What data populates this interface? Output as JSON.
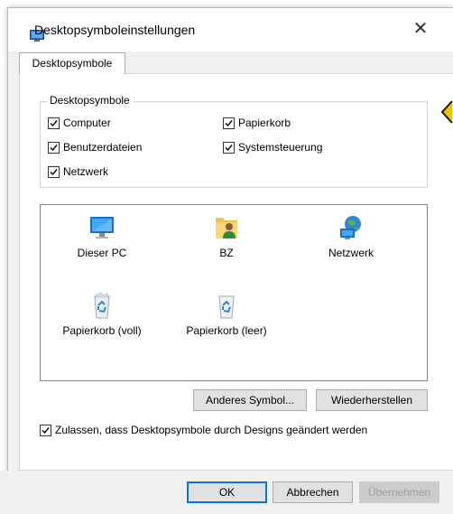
{
  "window": {
    "title": "Desktopsymboleinstellungen",
    "close_glyph": "✕"
  },
  "tabs": [
    {
      "label": "Desktopsymbole"
    }
  ],
  "group": {
    "legend": "Desktopsymbole",
    "checkboxes": [
      {
        "label": "Computer",
        "checked": true
      },
      {
        "label": "Papierkorb",
        "checked": true
      },
      {
        "label": "Benutzerdateien",
        "checked": true
      },
      {
        "label": "Systemsteuerung",
        "checked": true
      },
      {
        "label": "Netzwerk",
        "checked": true
      }
    ]
  },
  "icons": [
    {
      "label": "Dieser PC",
      "icon": "computer-icon"
    },
    {
      "label": "BZ",
      "icon": "user-folder-icon"
    },
    {
      "label": "Netzwerk",
      "icon": "network-globe-icon"
    },
    {
      "label": "Papierkorb (voll)",
      "icon": "recycle-bin-full-icon"
    },
    {
      "label": "Papierkorb (leer)",
      "icon": "recycle-bin-empty-icon"
    }
  ],
  "actions": {
    "change_icon": "Anderes Symbol...",
    "restore": "Wiederherstellen"
  },
  "allow_themes": {
    "label": "Zulassen, dass Desktopsymbole durch Designs geändert werden",
    "checked": true
  },
  "footer": {
    "ok": "OK",
    "cancel": "Abbrechen",
    "apply": "Übernehmen"
  },
  "colors": {
    "accent": "#0078d7",
    "annotation": "#f2c200"
  }
}
